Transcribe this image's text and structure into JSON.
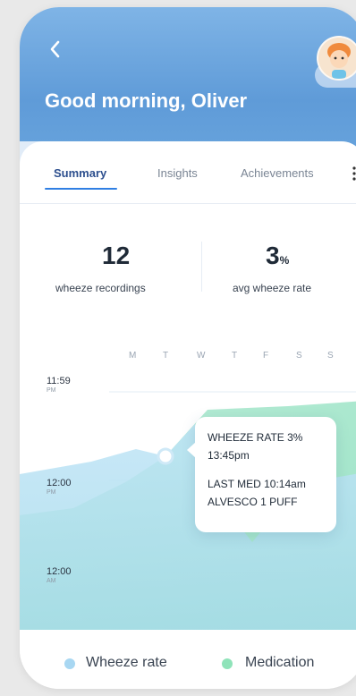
{
  "header": {
    "back_icon": "chevron-left-icon",
    "greeting": "Good morning, Oliver"
  },
  "tabs": [
    {
      "label": "Summary",
      "active": true
    },
    {
      "label": "Insights",
      "active": false
    },
    {
      "label": "Achievements",
      "active": false
    }
  ],
  "more_icon": "more-vertical-icon",
  "stats": {
    "recordings": {
      "value": "12",
      "label": "wheeze recordings"
    },
    "rate": {
      "value": "3",
      "unit": "%",
      "label": "avg wheeze rate"
    }
  },
  "days": [
    "M",
    "T",
    "W",
    "T",
    "F",
    "S",
    "S"
  ],
  "times": [
    {
      "time": "11:59",
      "period": "PM"
    },
    {
      "time": "12:00",
      "period": "PM"
    },
    {
      "time": "12:00",
      "period": "AM"
    }
  ],
  "tooltip": {
    "line1": "WHEEZE RATE 3%",
    "line2": "13:45pm",
    "line3": "LAST MED 10:14am",
    "line4": "ALVESCO 1 PUFF"
  },
  "legend": {
    "wheeze": {
      "label": "Wheeze rate",
      "color": "#a8d7f2"
    },
    "medication": {
      "label": "Medication",
      "color": "#8fe3b9"
    }
  }
}
